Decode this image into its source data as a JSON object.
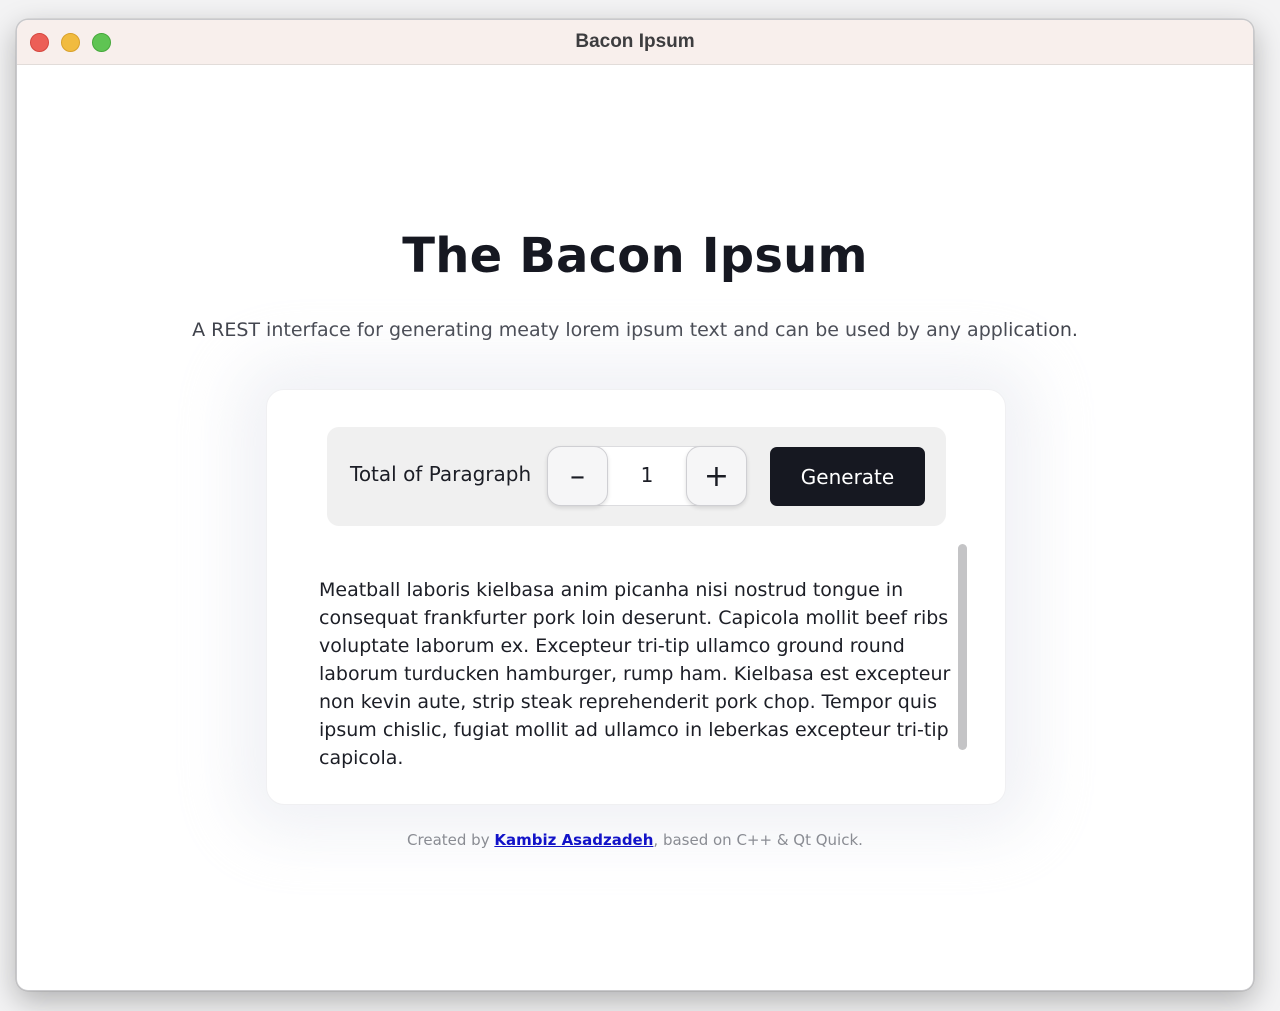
{
  "window": {
    "title": "Bacon Ipsum",
    "colors": {
      "close": "#ec5f57",
      "minimize": "#f1bb3f",
      "maximize": "#5fc453"
    }
  },
  "header": {
    "title": "The Bacon Ipsum",
    "subtitle": "A REST interface for generating meaty lorem ipsum text and can be used by any application."
  },
  "controls": {
    "paragraph_label": "Total of Paragraph",
    "decrement_label": "–",
    "increment_label": "+",
    "paragraph_count": "1",
    "generate_label": "Generate",
    "accent": "#161821"
  },
  "output": {
    "text": "Meatball laboris kielbasa anim picanha nisi nostrud tongue in consequat frankfurter pork loin deserunt.  Capicola mollit beef ribs voluptate laborum ex.  Excepteur tri-tip ullamco ground round laborum turducken hamburger, rump ham.  Kielbasa est excepteur non kevin aute, strip steak reprehenderit pork chop.  Tempor quis ipsum chislic, fugiat mollit ad ullamco in leberkas excepteur tri-tip capicola."
  },
  "footer": {
    "prefix": "Created by ",
    "author": "Kambiz Asadzadeh",
    "suffix": ", based on C++ & Qt Quick.",
    "link_color": "#1212c8"
  }
}
